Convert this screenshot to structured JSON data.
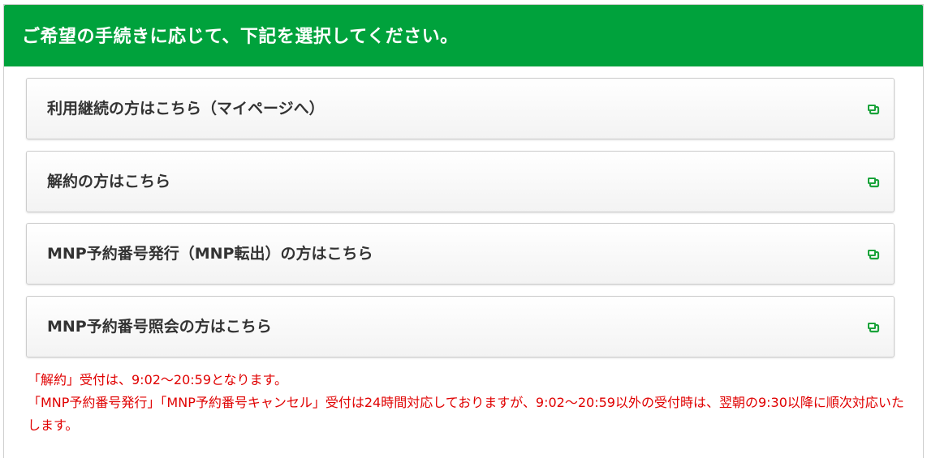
{
  "header": {
    "title": "ご希望の手続きに応じて、下記を選択してください。",
    "color": "#00a23c"
  },
  "menu": {
    "items": [
      {
        "label": "利用継続の方はこちら（マイページへ）",
        "icon": "external-link-icon"
      },
      {
        "label": "解約の方はこちら",
        "icon": "external-link-icon"
      },
      {
        "label": "MNP予約番号発行（MNP転出）の方はこちら",
        "icon": "external-link-icon"
      },
      {
        "label": "MNP予約番号照会の方はこちら",
        "icon": "external-link-icon"
      }
    ],
    "icon_color": "#1aa33a"
  },
  "notes": {
    "line1": "「解約」受付は、9:02～20:59となります。",
    "line2": "「MNP予約番号発行」「MNP予約番号キャンセル」受付は24時間対応しておりますが、9:02～20:59以外の受付時は、翌朝の9:30以降に順次対応いたします。",
    "color": "#e00000"
  }
}
